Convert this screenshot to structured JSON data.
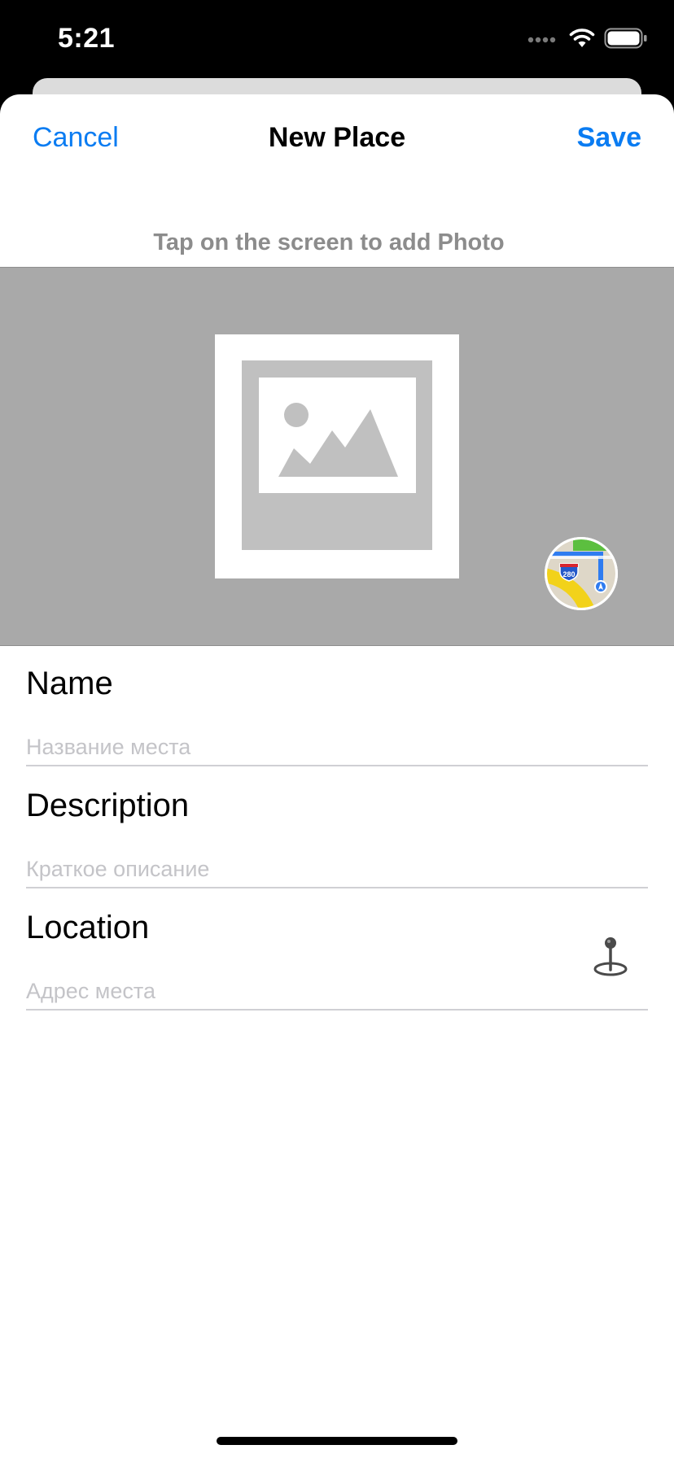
{
  "status_bar": {
    "time": "5:21",
    "icons": [
      "signal-icon",
      "wifi-icon",
      "battery-icon"
    ]
  },
  "nav": {
    "cancel_label": "Cancel",
    "title": "New Place",
    "save_label": "Save"
  },
  "photo": {
    "hint": "Tap on the screen to add Photo",
    "placeholder_icon": "image-placeholder-icon",
    "map_button_icon": "maps-app-icon",
    "map_badge_text": "280"
  },
  "form": {
    "name": {
      "label": "Name",
      "placeholder": "Название места",
      "value": ""
    },
    "description": {
      "label": "Description",
      "placeholder": "Краткое описание",
      "value": ""
    },
    "location": {
      "label": "Location",
      "placeholder": "Адрес места",
      "value": "",
      "action_icon": "map-pin-icon"
    }
  },
  "colors": {
    "accent": "#0a7cf2",
    "photo_background": "#a9a9a9",
    "placeholder_text": "#c4c4c8",
    "hint_text": "#8c8c8c"
  }
}
